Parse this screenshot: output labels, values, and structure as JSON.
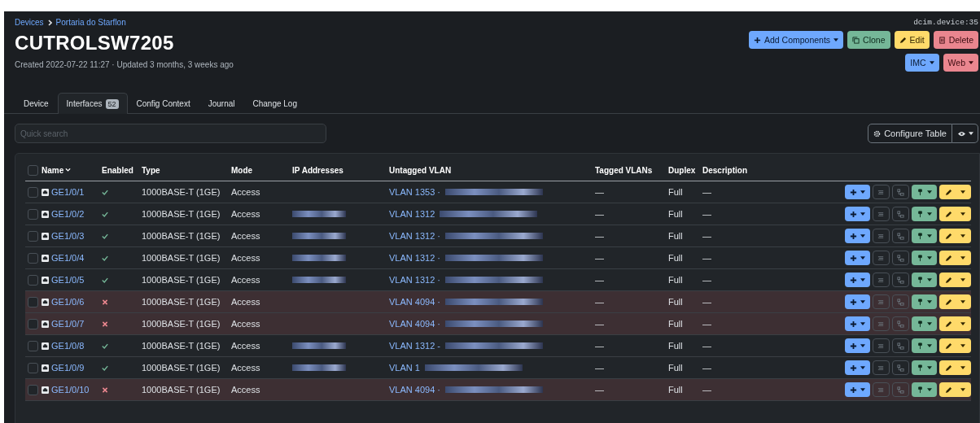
{
  "breadcrumb": [
    "Devices",
    "Portaria do Starflon"
  ],
  "object_id": "dcim.device:35",
  "title": "CUTROLSW7205",
  "subtitle": "Created 2022-07-22 11:27 · Updated 3 months, 3 weeks ago",
  "actions": [
    {
      "label": "Add Components",
      "kind": "add",
      "dropdown": true
    },
    {
      "label": "Clone",
      "kind": "clone",
      "dropdown": false
    },
    {
      "label": "Edit",
      "kind": "edit",
      "dropdown": false
    },
    {
      "label": "Delete",
      "kind": "delete",
      "dropdown": false
    }
  ],
  "actions_row2": [
    {
      "label": "IMC",
      "kind": "add",
      "dropdown": true
    },
    {
      "label": "Web",
      "kind": "delete",
      "dropdown": true
    }
  ],
  "tabs": [
    {
      "label": "Device",
      "selected": false
    },
    {
      "label": "Interfaces",
      "badge": "52",
      "selected": true
    },
    {
      "label": "Config Context",
      "selected": false
    },
    {
      "label": "Journal",
      "selected": false
    },
    {
      "label": "Change Log",
      "selected": false
    }
  ],
  "search": {
    "placeholder": "Quick search"
  },
  "configure_button": "Configure Table",
  "table": {
    "all_selected": false,
    "columns": [
      {
        "label": "Name",
        "sorted": true
      },
      {
        "label": "Enabled",
        "sorted": false
      },
      {
        "label": "Type",
        "sorted": false
      },
      {
        "label": "Mode",
        "sorted": false
      },
      {
        "label": "IP Addresses",
        "sorted": false
      },
      {
        "label": "Untagged VLAN",
        "sorted": false
      },
      {
        "label": "Tagged VLANs",
        "sorted": false
      },
      {
        "label": "Duplex",
        "sorted": false
      },
      {
        "label": "Description",
        "sorted": false
      }
    ],
    "rows": [
      {
        "name": "GE1/0/1",
        "enabled": true,
        "selected": false,
        "type": "1000BASE-T (1GE)",
        "mode": "Access",
        "ip_redacted": false,
        "untagged_vlan": "VLAN 1353 ·",
        "tagged_vlans": "—",
        "duplex": "Full",
        "description": "—"
      },
      {
        "name": "GE1/0/2",
        "enabled": true,
        "selected": false,
        "type": "1000BASE-T (1GE)",
        "mode": "Access",
        "ip_redacted": true,
        "untagged_vlan": "VLAN 1312",
        "tagged_vlans": "—",
        "duplex": "Full",
        "description": "—"
      },
      {
        "name": "GE1/0/3",
        "enabled": true,
        "selected": false,
        "type": "1000BASE-T (1GE)",
        "mode": "Access",
        "ip_redacted": true,
        "untagged_vlan": "VLAN 1312 ·",
        "tagged_vlans": "—",
        "duplex": "Full",
        "description": "—"
      },
      {
        "name": "GE1/0/4",
        "enabled": true,
        "selected": false,
        "type": "1000BASE-T (1GE)",
        "mode": "Access",
        "ip_redacted": true,
        "untagged_vlan": "VLAN 1312 ·",
        "tagged_vlans": "—",
        "duplex": "Full",
        "description": "—"
      },
      {
        "name": "GE1/0/5",
        "enabled": true,
        "selected": false,
        "type": "1000BASE-T (1GE)",
        "mode": "Access",
        "ip_redacted": true,
        "untagged_vlan": "VLAN 1312 ·",
        "tagged_vlans": "—",
        "duplex": "Full",
        "description": "—"
      },
      {
        "name": "GE1/0/6",
        "enabled": false,
        "selected": false,
        "type": "1000BASE-T (1GE)",
        "mode": "Access",
        "ip_redacted": false,
        "untagged_vlan": "VLAN 4094 ·",
        "tagged_vlans": "—",
        "duplex": "Full",
        "description": "—"
      },
      {
        "name": "GE1/0/7",
        "enabled": false,
        "selected": false,
        "type": "1000BASE-T (1GE)",
        "mode": "Access",
        "ip_redacted": false,
        "untagged_vlan": "VLAN 4094 ·",
        "tagged_vlans": "—",
        "duplex": "Full",
        "description": "—"
      },
      {
        "name": "GE1/0/8",
        "enabled": true,
        "selected": false,
        "type": "1000BASE-T (1GE)",
        "mode": "Access",
        "ip_redacted": true,
        "untagged_vlan": "VLAN 1312 -",
        "tagged_vlans": "—",
        "duplex": "Full",
        "description": "—"
      },
      {
        "name": "GE1/0/9",
        "enabled": true,
        "selected": false,
        "type": "1000BASE-T (1GE)",
        "mode": "Access",
        "ip_redacted": true,
        "untagged_vlan": "VLAN 1",
        "tagged_vlans": "—",
        "duplex": "Full",
        "description": "—"
      },
      {
        "name": "GE1/0/10",
        "enabled": false,
        "selected": false,
        "type": "1000BASE-T (1GE)",
        "mode": "Access",
        "ip_redacted": false,
        "untagged_vlan": "VLAN 4094 ·",
        "tagged_vlans": "—",
        "duplex": "Full",
        "description": "—"
      }
    ]
  }
}
